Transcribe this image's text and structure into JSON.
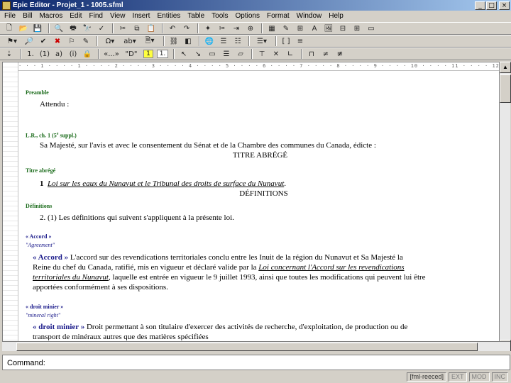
{
  "window": {
    "title": "Epic Editor - Projet_1 - 1005.sfml"
  },
  "menu": [
    "File",
    "Bill",
    "Macros",
    "Edit",
    "Find",
    "View",
    "Insert",
    "Entities",
    "Table",
    "Tools",
    "Options",
    "Format",
    "Window",
    "Help"
  ],
  "toolbar3": {
    "items": [
      "1.",
      "(1)",
      "a)",
      "(i)",
      "«...»",
      "\"D\"",
      "1",
      "1."
    ]
  },
  "ruler_text": "· · · 1 · · · · 1 · · · · 2 · · · · 3 · · · · 4 · · · · 5 · · · · 6 · · · · 7 · · · · 8 · · · · 9 · · · · 10 · · · · 11 · · · · 12 · · · ·",
  "document": {
    "preamble_label": "Preamble",
    "preamble_text": "Attendu :",
    "lr_label": "L.R., ch. 1 (5",
    "lr_sup": "e",
    "lr_label_end": " suppl.)",
    "enacting_text": "Sa Majesté, sur l'avis et avec le consentement du Sénat et de la Chambre des communes du Canada, édicte :",
    "heading_short_title": "TITRE ABRÉGÉ",
    "short_title_label": "Titre abrégé",
    "s1_num": "1",
    "s1_title": "Loi sur les eaux du Nunavut et le Tribunal des droits de surface du Nunavut",
    "s1_end": ".",
    "heading_definitions": "DÉFINITIONS",
    "definitions_label": "Définitions",
    "s2_num": "2.",
    "s2_sub": "(1)",
    "s2_text": "Les définitions qui suivent s'appliquent à la présente loi.",
    "def1_label": "« Accord »",
    "def1_label_en": "\"Agreement\"",
    "def1_term": "« Accord »",
    "def1_line1": " L'accord sur des revendications territoriales conclu entre les Inuit de la région du Nunavut et Sa Majesté la",
    "def1_line2a": "Reine du chef du Canada, ratifié, mis en vigueur et déclaré valide par la ",
    "def1_line2b": "Loi concernant l'Accord sur les revendications",
    "def1_line3a": "territoriales du Nunavut",
    "def1_line3b": ", laquelle est entrée en vigueur le 9 juillet 1993, ainsi que toutes les modifications qui peuvent lui être",
    "def1_line4": "apportées conformément à ses dispositions.",
    "def2_label": "« droit minier »",
    "def2_label_en": "\"mineral right\"",
    "def2_term": "« droit minier »",
    "def2_line1": " Droit permettant à son titulaire d'exercer des activités de recherche, d'exploitation, de production ou de",
    "def2_line2": "transport de minéraux autres que des matières spécifiées"
  },
  "command": {
    "label": "Command:"
  },
  "status": [
    "[fml-reeced]",
    "EXT",
    "MOD",
    "INC"
  ]
}
